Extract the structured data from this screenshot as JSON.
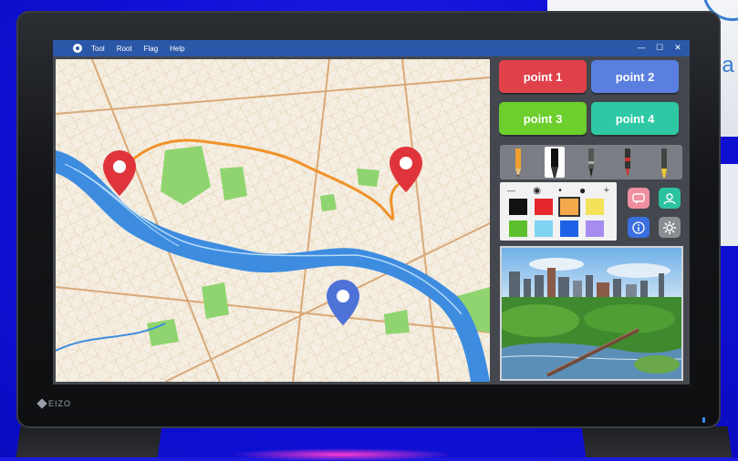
{
  "window": {
    "menu": [
      "Tool",
      "Root",
      "Flag",
      "Help"
    ],
    "controls": [
      "—",
      "☐",
      "✕"
    ]
  },
  "monitor": {
    "brand": "EIZO"
  },
  "background": {
    "partial_text": "ea"
  },
  "points": [
    {
      "label": "point 1",
      "color": "#e0414a"
    },
    {
      "label": "point 2",
      "color": "#5a7fe0"
    },
    {
      "label": "point 3",
      "color": "#6ccf2b"
    },
    {
      "label": "point 4",
      "color": "#2ec9a4"
    }
  ],
  "pens": [
    "pencil-icon",
    "marker-icon",
    "fineliner-icon",
    "red-pen-icon",
    "highlighter-icon"
  ],
  "palette": {
    "sizes": [
      "—",
      "◉",
      "•",
      "●",
      "+"
    ],
    "colors": [
      "#111111",
      "#e4282c",
      "#f5a94a",
      "#f3e25a",
      "#5cc02c",
      "#7fd3f3",
      "#1d62e6",
      "#a68cf0"
    ],
    "selected": "#f5a94a"
  },
  "icon_buttons": [
    {
      "name": "comment-icon",
      "color": "#ef8fa0"
    },
    {
      "name": "user-icon",
      "color": "#2cc2a0"
    },
    {
      "name": "info-icon",
      "color": "#3a6fe0"
    },
    {
      "name": "gear-icon",
      "color": "#8a8d92"
    }
  ],
  "map": {
    "pins": [
      {
        "name": "start",
        "color": "#e0343c"
      },
      {
        "name": "end",
        "color": "#e0343c"
      },
      {
        "name": "marker",
        "color": "#4e72d8"
      }
    ],
    "route_color": "#f0922a"
  }
}
